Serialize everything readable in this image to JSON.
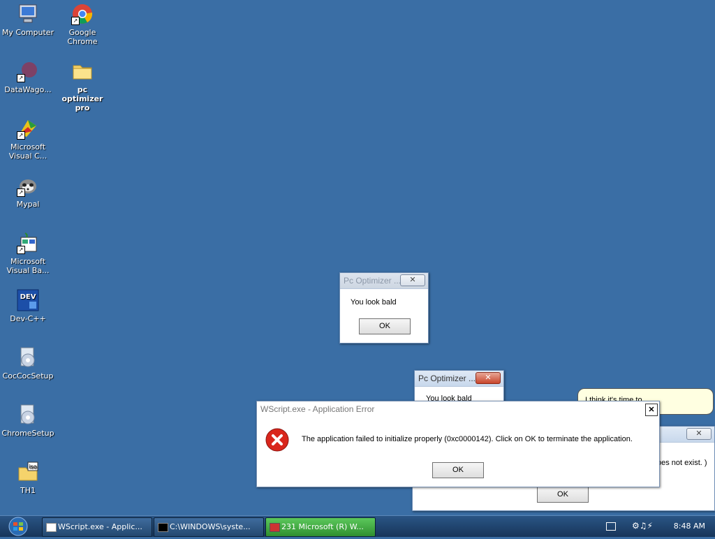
{
  "desktop_icons": [
    {
      "label": "My Computer",
      "icon": "computer-icon"
    },
    {
      "label": "Google Chrome",
      "icon": "chrome-icon"
    },
    {
      "label": "DataWago...",
      "icon": "datawago-icon"
    },
    {
      "label": "pc optimizer pro",
      "icon": "folder-icon"
    },
    {
      "label": "Microsoft Visual C...",
      "icon": "visual-c-icon"
    },
    {
      "label": "Mypal",
      "icon": "mypal-icon"
    },
    {
      "label": "Microsoft Visual Ba...",
      "icon": "visual-basic-icon"
    },
    {
      "label": "Dev-C++",
      "icon": "dev-cpp-icon"
    },
    {
      "label": "CocCocSetup",
      "icon": "setup-icon"
    },
    {
      "label": "ChromeSetup",
      "icon": "setup-icon"
    },
    {
      "label": "TH1",
      "icon": "iso-icon"
    }
  ],
  "dialog_top": {
    "title": "Pc Optimizer ...",
    "message": "You look bald",
    "ok": "OK",
    "close": "✕"
  },
  "dialog_mid": {
    "title": "Pc Optimizer ...",
    "message": "You look bald",
    "close": "✕"
  },
  "dialog_right": {
    "message": "oes not exist. )",
    "ok": "OK",
    "close": "✕"
  },
  "tooltip": {
    "text": "I think it's time to ......"
  },
  "error_dialog": {
    "title": "WScript.exe - Application Error",
    "message": "The application failed to initialize properly (0xc0000142). Click on OK to terminate the application.",
    "ok": "OK",
    "close": "✕"
  },
  "taskbar": {
    "buttons": [
      {
        "label": "WScript.exe - Applic...",
        "icon": "window-icon"
      },
      {
        "label": "C:\\WINDOWS\\syste...",
        "icon": "console-icon"
      },
      {
        "label": "231 Microsoft (R) W...",
        "icon": "script-icon"
      }
    ],
    "clock": "8:48 AM"
  },
  "colors": {
    "desktop": "#3a6ea5",
    "error_red": "#d9261c"
  }
}
